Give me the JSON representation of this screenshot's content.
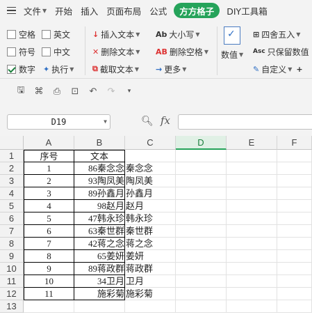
{
  "menubar": {
    "file_label": "文件",
    "tabs": [
      "开始",
      "插入",
      "页面布局",
      "公式"
    ],
    "active_tab": "方方格子",
    "extra_tab": "DIY工具箱"
  },
  "ribbon": {
    "checks": [
      {
        "label": "空格",
        "checked": false
      },
      {
        "label": "英文",
        "checked": false
      },
      {
        "label": "符号",
        "checked": false
      },
      {
        "label": "中文",
        "checked": false
      },
      {
        "label": "数字",
        "checked": true
      },
      {
        "label": "执行",
        "checked": false
      }
    ],
    "text_tools": [
      "插入文本",
      "删除文本",
      "截取文本"
    ],
    "case_tools": [
      "大小写",
      "删除空格",
      "更多"
    ],
    "numeric_label": "数值",
    "numeric_tools": [
      "四舍五入",
      "只保留数值",
      "自定义"
    ]
  },
  "formula_bar": {
    "cell_ref": "D19",
    "fx": "fx"
  },
  "sheet": {
    "columns": [
      "A",
      "B",
      "C",
      "D",
      "E",
      "F"
    ],
    "active_column": "D",
    "row_numbers": [
      "1",
      "2",
      "3",
      "4",
      "5",
      "6",
      "7",
      "8",
      "9",
      "10",
      "11",
      "12",
      "13"
    ],
    "header": {
      "a": "序号",
      "b": "文本",
      "c": ""
    },
    "rows": [
      {
        "a": "1",
        "b": "86秦念念",
        "c": "秦念念"
      },
      {
        "a": "2",
        "b": "93陶凤美",
        "c": "陶凤美"
      },
      {
        "a": "3",
        "b": "89孙鑫月",
        "c": "孙鑫月"
      },
      {
        "a": "4",
        "b": "98赵月",
        "c": "赵月"
      },
      {
        "a": "5",
        "b": "47韩永珍",
        "c": "韩永珍"
      },
      {
        "a": "6",
        "b": "63秦世群",
        "c": "秦世群"
      },
      {
        "a": "7",
        "b": "42蒋之念",
        "c": "蒋之念"
      },
      {
        "a": "8",
        "b": "65姜妍",
        "c": "姜妍"
      },
      {
        "a": "9",
        "b": "89蒋政群",
        "c": "蒋政群"
      },
      {
        "a": "10",
        "b": "34卫月",
        "c": "卫月"
      },
      {
        "a": "11",
        "b": "施彩菊",
        "c": "施彩菊"
      }
    ]
  }
}
